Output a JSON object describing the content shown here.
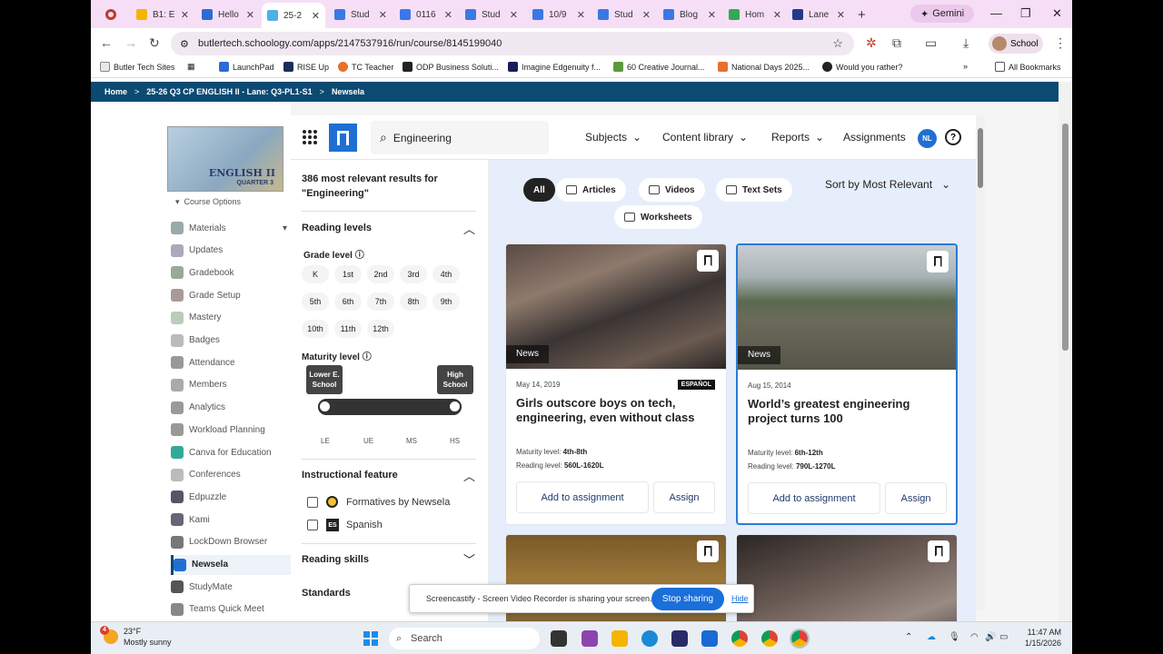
{
  "browser": {
    "tabs": [
      {
        "label": "B1: E",
        "color": "#f4b400",
        "active": false
      },
      {
        "label": "Hello",
        "color": "#2b6cd3",
        "active": false
      },
      {
        "label": "25-2",
        "color": "#4fb0e8",
        "active": true
      },
      {
        "label": "Stud",
        "color": "#3b78e7",
        "active": false
      },
      {
        "label": "0116",
        "color": "#3b78e7",
        "active": false
      },
      {
        "label": "Stud",
        "color": "#3b78e7",
        "active": false
      },
      {
        "label": "10/9",
        "color": "#3b78e7",
        "active": false
      },
      {
        "label": "Stud",
        "color": "#3b78e7",
        "active": false
      },
      {
        "label": "Blog",
        "color": "#3b78e7",
        "active": false
      },
      {
        "label": "Hom",
        "color": "#34a853",
        "active": false
      },
      {
        "label": "Lane",
        "color": "#1f3a8a",
        "active": false
      }
    ],
    "gemini_label": "Gemini",
    "url": "butlertech.schoology.com/apps/2147537916/run/course/8145199040",
    "profile_label": "School",
    "bookmarks": [
      "Butler Tech Sites",
      "LaunchPad",
      "RISE Up",
      "TC Teacher",
      "ODP Business Soluti...",
      "Imagine Edgenuity f...",
      "60 Creative Journal...",
      "National Days 2025...",
      "Would you rather?"
    ],
    "all_bookmarks": "All Bookmarks"
  },
  "breadcrumb": [
    "Home",
    "25-26 Q3 CP ENGLISH II - Lane: Q3-PL1-S1",
    "Newsela"
  ],
  "schoology": {
    "logo_title": "ENGLISH II",
    "logo_sub": "QUARTER 3",
    "course_options": "Course Options",
    "nav": [
      "Materials",
      "Updates",
      "Gradebook",
      "Grade Setup",
      "Mastery",
      "Badges",
      "Attendance",
      "Members",
      "Analytics",
      "Workload Planning",
      "Canva for Education",
      "Conferences",
      "Edpuzzle",
      "Kami",
      "LockDown Browser",
      "Newsela",
      "StudyMate",
      "Teams Quick Meet"
    ],
    "active_nav": "Newsela"
  },
  "newsela": {
    "search_value": "Engineering",
    "nav": {
      "subjects": "Subjects",
      "content_library": "Content library",
      "reports": "Reports",
      "assignments": "Assignments"
    },
    "avatar_initials": "NL",
    "help": "?",
    "results_heading": "386 most relevant results for \"Engineering\"",
    "reading_levels": "Reading levels",
    "grade_level": "Grade level",
    "grades": [
      "K",
      "1st",
      "2nd",
      "3rd",
      "4th",
      "5th",
      "6th",
      "7th",
      "8th",
      "9th",
      "10th",
      "11th",
      "12th"
    ],
    "maturity_level": "Maturity level",
    "maturity_low": "Lower E. School",
    "maturity_high": "High School",
    "maturity_ticks": [
      "LE",
      "UE",
      "MS",
      "HS"
    ],
    "instructional_feature": "Instructional feature",
    "features": [
      "Formatives by Newsela",
      "Spanish"
    ],
    "spanish_badge": "ES",
    "reading_skills": "Reading skills",
    "standards": "Standards",
    "content_tabs": [
      "All",
      "Articles",
      "Videos",
      "Text Sets",
      "Worksheets"
    ],
    "selected_tab": "All",
    "sort": "Sort by Most Relevant",
    "cards": [
      {
        "tag": "News",
        "date": "May 14, 2019",
        "badge": "ESPAÑOL",
        "title": "Girls outscore boys on tech, engineering, even without class",
        "maturity_label": "Maturity level:",
        "maturity": "4th-8th",
        "reading_label": "Reading level:",
        "reading": "560L-1620L",
        "add": "Add to assignment",
        "assign": "Assign"
      },
      {
        "tag": "News",
        "date": "Aug 15, 2014",
        "badge": "",
        "title": "World’s greatest engineering project turns 100",
        "maturity_label": "Maturity level:",
        "maturity": "6th-12th",
        "reading_label": "Reading level:",
        "reading": "790L-1270L",
        "add": "Add to assignment",
        "assign": "Assign"
      }
    ]
  },
  "share_bar": {
    "text": "Screencastify - Screen Video Recorder is sharing your screen.",
    "stop": "Stop sharing",
    "hide": "Hide"
  },
  "taskbar": {
    "temp": "23°F",
    "condition": "Mostly sunny",
    "badge": "4",
    "search": "Search",
    "time": "11:47 AM",
    "date": "1/15/2026"
  }
}
